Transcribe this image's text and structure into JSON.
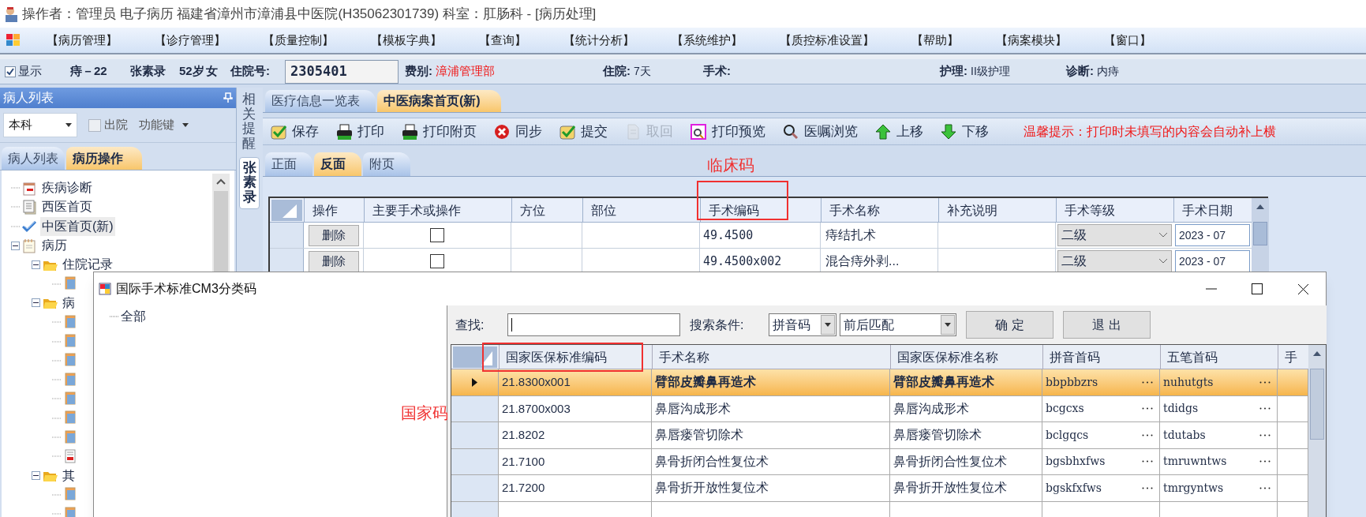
{
  "window": {
    "title": "操作者：管理员 电子病历  福建省漳州市漳浦县中医院(H35062301739)  科室：肛肠科 - [病历处理]"
  },
  "menu": [
    "【病历管理】",
    "【诊疗管理】",
    "【质量控制】",
    "【模板字典】",
    "【查询】",
    "【统计分析】",
    "【系统维护】",
    "【质控标准设置】",
    "【帮助】",
    "【病案模块】",
    "【窗口】"
  ],
  "patient_bar": {
    "show": {
      "label": "显示",
      "checked": true
    },
    "diagnosis_code": "痔－22",
    "name": "张素录",
    "age": "52岁",
    "sex": "女",
    "admission_no": {
      "label": "住院号:",
      "value": "2305401"
    },
    "fields": [
      {
        "label": "费别:",
        "value": "漳浦管理部",
        "kind": "alert"
      },
      {
        "label": "住院:",
        "value": "7天",
        "kind": "plain"
      },
      {
        "label": "手术:"
      },
      {
        "label": "护理:",
        "value": "II级护理",
        "kind": "plain"
      },
      {
        "label": "诊断:",
        "value": "内痔",
        "kind": "plain"
      }
    ]
  },
  "left_panel": {
    "title": "病人列表",
    "scope": "本科",
    "discharged": {
      "label": "出院",
      "checked": false
    },
    "function_keys": "功能键",
    "tabs": [
      {
        "label": "病人列表",
        "selected": false
      },
      {
        "label": "病历操作",
        "selected": true
      }
    ],
    "tree": [
      {
        "label": "疾病诊断",
        "kind": "calendar",
        "selected": false
      },
      {
        "label": "西医首页",
        "kind": "pages",
        "selected": false
      },
      {
        "label": "中医首页(新)",
        "kind": "check",
        "selected": true
      },
      {
        "label": "病历",
        "kind": "notebook",
        "selected": false,
        "expanded": true,
        "children": [
          {
            "label": "住院记录",
            "kind": "folder",
            "selected": false,
            "expanded": true,
            "children": [
              {
                "kind": "record"
              }
            ]
          },
          {
            "label": "病",
            "kind": "folder",
            "selected": false,
            "expanded": true,
            "children": [
              {
                "kind": "record"
              },
              {
                "kind": "record"
              },
              {
                "kind": "record"
              },
              {
                "kind": "record"
              },
              {
                "kind": "record"
              },
              {
                "kind": "record"
              },
              {
                "kind": "record"
              },
              {
                "kind": "form"
              }
            ]
          },
          {
            "label": "其",
            "kind": "folder",
            "selected": false,
            "expanded": true,
            "children": [
              {
                "kind": "record"
              },
              {
                "kind": "record"
              }
            ]
          }
        ]
      }
    ]
  },
  "side_tabs": [
    {
      "label": "相关提醒",
      "selected": false
    },
    {
      "label": "张素录",
      "selected": true
    }
  ],
  "doc_tabs": [
    {
      "label": "医疗信息一览表",
      "selected": false
    },
    {
      "label": "中医病案首页(新)",
      "selected": true
    }
  ],
  "toolbar": [
    {
      "label": "保存",
      "kind": "check",
      "disabled": false
    },
    {
      "label": "打印",
      "kind": "printer",
      "disabled": false
    },
    {
      "label": "打印附页",
      "kind": "printer",
      "disabled": false
    },
    {
      "label": "同步",
      "kind": "cancel",
      "disabled": false
    },
    {
      "label": "提交",
      "kind": "check",
      "disabled": false
    },
    {
      "label": "取回",
      "kind": "document",
      "disabled": true
    },
    {
      "label": "打印预览",
      "kind": "preview",
      "disabled": false
    },
    {
      "label": "医嘱浏览",
      "kind": "search",
      "disabled": false
    },
    {
      "label": "上移",
      "kind": "up",
      "disabled": false
    },
    {
      "label": "下移",
      "kind": "down",
      "disabled": false
    }
  ],
  "hint": "温馨提示：打印时未填写的内容会自动补上横",
  "page_tabs": [
    {
      "label": "正面",
      "selected": false
    },
    {
      "label": "反面",
      "selected": true
    },
    {
      "label": "附页",
      "selected": false
    }
  ],
  "surgery_table": {
    "columns": [
      "操作",
      "主要手术或操作",
      "方位",
      "部位",
      "手术编码",
      "手术名称",
      "补充说明",
      "手术等级",
      "手术日期"
    ],
    "rows": [
      {
        "action": "删除",
        "main": false,
        "code": "49.4500",
        "name": "痔结扎术",
        "grade": "二级",
        "date": "2023 - 07"
      },
      {
        "action": "删除",
        "main": false,
        "code": "49.4500x002",
        "name": "混合痔外剥...",
        "grade": "二级",
        "date": "2023 - 07"
      }
    ]
  },
  "annotations": [
    {
      "label": "临床码"
    },
    {
      "label": "国家码"
    }
  ],
  "dialog": {
    "title": "国际手术标准CM3分类码",
    "tree": [
      "全部"
    ],
    "search_label": "查找:",
    "condition_label": "搜索条件:",
    "condition": "拼音码",
    "match": "前后匹配",
    "buttons": [
      "确 定",
      "退 出"
    ],
    "columns": [
      "国家医保标准编码",
      "手术名称",
      "国家医保标准名称",
      "拼音首码",
      "五笔首码",
      "手"
    ],
    "rows": [
      {
        "code": "21.8300x001",
        "name": "臂部皮瓣鼻再造术",
        "std_name": "臂部皮瓣鼻再造术",
        "pinyin": "bbpbbzrs",
        "wubi": "nuhutgts",
        "selected": true
      },
      {
        "code": "21.8700x003",
        "name": "鼻唇沟成形术",
        "std_name": "鼻唇沟成形术",
        "pinyin": "bcgcxs",
        "wubi": "tdidgs",
        "selected": false
      },
      {
        "code": "21.8202",
        "name": "鼻唇瘘管切除术",
        "std_name": "鼻唇瘘管切除术",
        "pinyin": "bclgqcs",
        "wubi": "tdutabs",
        "selected": false
      },
      {
        "code": "21.7100",
        "name": "鼻骨折闭合性复位术",
        "std_name": "鼻骨折闭合性复位术",
        "pinyin": "bgsbhxfws",
        "wubi": "tmruwntws",
        "selected": false
      },
      {
        "code": "21.7200",
        "name": "鼻骨折开放性复位术",
        "std_name": "鼻骨折开放性复位术",
        "pinyin": "bgskfxfws",
        "wubi": "tmrgyntws",
        "selected": false
      }
    ]
  }
}
